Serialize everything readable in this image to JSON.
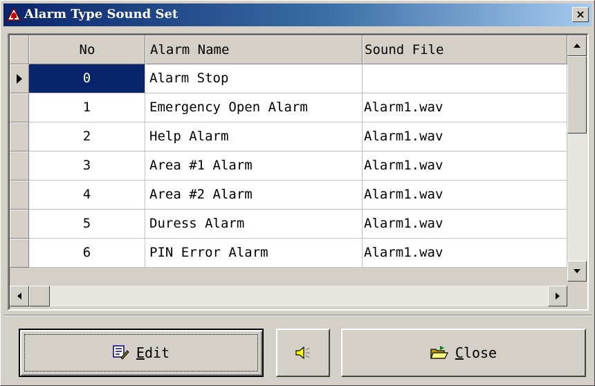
{
  "window": {
    "title": "Alarm Type Sound Set",
    "close_glyph": "×",
    "title_icon": "alarm-bell-icon"
  },
  "grid": {
    "columns": [
      "No",
      "Alarm Name",
      "Sound File"
    ],
    "rows": [
      {
        "no": "0",
        "name": "Alarm Stop",
        "file": ""
      },
      {
        "no": "1",
        "name": "Emergency Open Alarm",
        "file": "Alarm1.wav"
      },
      {
        "no": "2",
        "name": "Help Alarm",
        "file": "Alarm1.wav"
      },
      {
        "no": "3",
        "name": "Area #1 Alarm",
        "file": "Alarm1.wav"
      },
      {
        "no": "4",
        "name": "Area #2 Alarm",
        "file": "Alarm1.wav"
      },
      {
        "no": "5",
        "name": "Duress Alarm",
        "file": "Alarm1.wav"
      },
      {
        "no": "6",
        "name": "PIN Error Alarm",
        "file": "Alarm1.wav"
      }
    ],
    "selected_row": 0
  },
  "buttons": {
    "edit_accel": "E",
    "edit_rest": "dit",
    "close_accel": "C",
    "close_rest": "lose",
    "edit_icon": "edit-icon",
    "sound_icon": "speaker-icon",
    "close_icon": "folder-open-icon"
  },
  "colors": {
    "selection": "#0a246a",
    "title_start": "#0a246a",
    "title_end": "#a6caf0",
    "face": "#d4d0c8"
  }
}
